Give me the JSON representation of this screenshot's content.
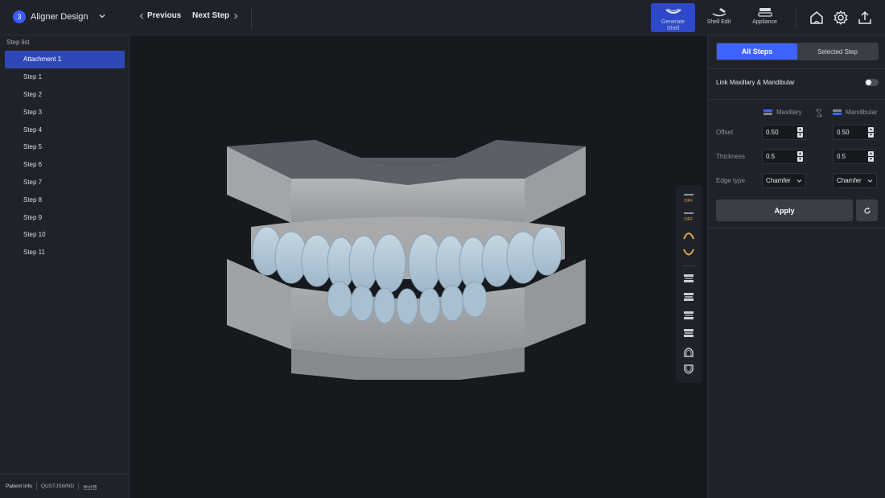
{
  "header": {
    "step_number": "3",
    "title": "Aligner Design",
    "previous_label": "Previous",
    "next_label": "Next Step",
    "tools": [
      {
        "label": "Generate Shell",
        "icon": "generate-shell-icon",
        "active": true
      },
      {
        "label": "Shell Edit",
        "icon": "shell-edit-icon",
        "active": false
      },
      {
        "label": "Appliance",
        "icon": "appliance-icon",
        "active": false
      }
    ],
    "actions": [
      "home-icon",
      "settings-gear-icon",
      "export-upload-icon"
    ],
    "accent_color": "#3e63ff"
  },
  "sidebar": {
    "title": "Step list",
    "items": [
      {
        "label": "Attachment 1",
        "selected": true
      },
      {
        "label": "Step 1"
      },
      {
        "label": "Step 2"
      },
      {
        "label": "Step 3"
      },
      {
        "label": "Step 4"
      },
      {
        "label": "Step 5"
      },
      {
        "label": "Step 6"
      },
      {
        "label": "Step 7"
      },
      {
        "label": "Step 8"
      },
      {
        "label": "Step 9"
      },
      {
        "label": "Step 10"
      },
      {
        "label": "Step 11"
      }
    ],
    "footer": {
      "label": "Patient Info",
      "patient_id": "QUSTJSWND",
      "name": "변선종"
    }
  },
  "viewport": {
    "side_tools": [
      "gingiva-off-icon",
      "attachment-off-icon",
      "upper-arch-icon",
      "lower-arch-icon",
      "view-front-icon",
      "view-back-icon",
      "view-left-icon",
      "view-right-icon",
      "view-top-icon",
      "view-bottom-icon"
    ]
  },
  "panel": {
    "tabs": [
      {
        "label": "All Steps",
        "active": true
      },
      {
        "label": "Selected Step",
        "active": false
      }
    ],
    "link_label": "Link Maxillary & Mandibular",
    "link_enabled": false,
    "maxillary_label": "Maxillary",
    "mandibular_label": "Mandibular",
    "offset_label": "Offset",
    "thickness_label": "Thickness",
    "edge_label": "Edge type",
    "maxillary": {
      "offset": "0.50",
      "thickness": "0.5",
      "edge": "Chamfer"
    },
    "mandibular": {
      "offset": "0.50",
      "thickness": "0.5",
      "edge": "Chamfer"
    },
    "apply_label": "Apply"
  }
}
